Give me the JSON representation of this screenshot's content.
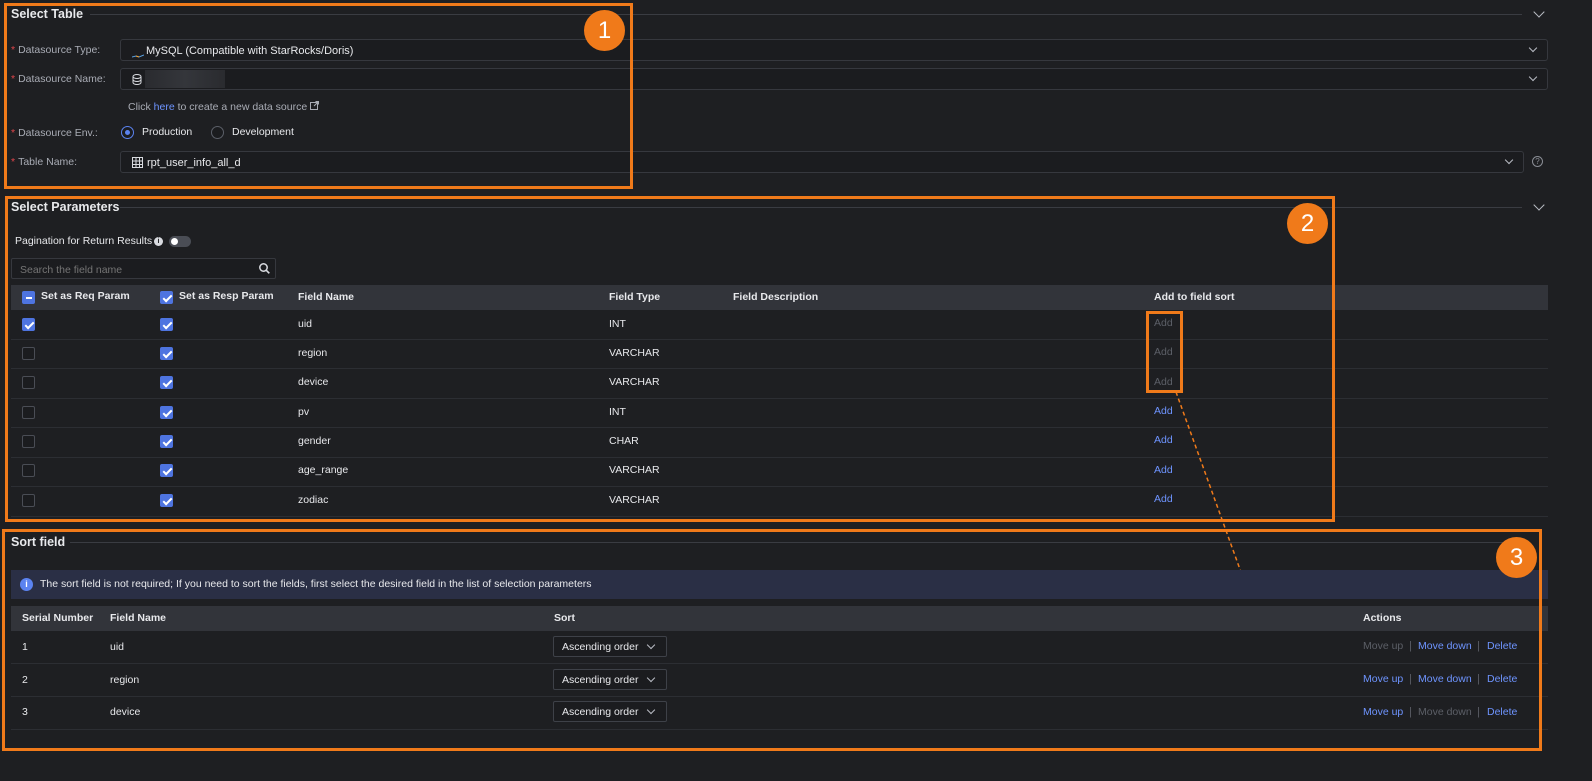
{
  "select_table": {
    "title": "Select Table",
    "datasource_type": {
      "label": "Datasource Type:",
      "value": "MySQL (Compatible with StarRocks/Doris)"
    },
    "datasource_name": {
      "label": "Datasource Name:",
      "value": ""
    },
    "create_hint": {
      "prefix": "Click ",
      "link": "here",
      "suffix": " to create a new data source"
    },
    "datasource_env": {
      "label": "Datasource Env.:",
      "options": [
        "Production",
        "Development"
      ],
      "selected": "Production"
    },
    "table_name": {
      "label": "Table Name:",
      "value": "rpt_user_info_all_d"
    }
  },
  "select_parameters": {
    "title": "Select Parameters",
    "pagination_label": "Pagination for Return Results",
    "pagination_enabled": false,
    "search_placeholder": "Search the field name",
    "columns": [
      "Set as Req Param",
      "Set as Resp Param",
      "Field Name",
      "Field Type",
      "Field Description",
      "Add to field sort"
    ],
    "rows": [
      {
        "req": true,
        "resp": true,
        "field": "uid",
        "type": "INT",
        "desc": "",
        "action": "Add",
        "action_enabled": false
      },
      {
        "req": false,
        "resp": true,
        "field": "region",
        "type": "VARCHAR",
        "desc": "",
        "action": "Add",
        "action_enabled": false
      },
      {
        "req": false,
        "resp": true,
        "field": "device",
        "type": "VARCHAR",
        "desc": "",
        "action": "Add",
        "action_enabled": false
      },
      {
        "req": false,
        "resp": true,
        "field": "pv",
        "type": "INT",
        "desc": "",
        "action": "Add",
        "action_enabled": true
      },
      {
        "req": false,
        "resp": true,
        "field": "gender",
        "type": "CHAR",
        "desc": "",
        "action": "Add",
        "action_enabled": true
      },
      {
        "req": false,
        "resp": true,
        "field": "age_range",
        "type": "VARCHAR",
        "desc": "",
        "action": "Add",
        "action_enabled": true
      },
      {
        "req": false,
        "resp": true,
        "field": "zodiac",
        "type": "VARCHAR",
        "desc": "",
        "action": "Add",
        "action_enabled": true
      }
    ]
  },
  "sort_field": {
    "title": "Sort field",
    "info": "The sort field is not required; If you need to sort the fields, first select the desired field in the list of selection parameters",
    "columns": [
      "Serial Number",
      "Field Name",
      "Sort",
      "Actions"
    ],
    "rows": [
      {
        "serial": "1",
        "field": "uid",
        "sort": "Ascending order",
        "move_up": "Move up",
        "move_down": "Move down",
        "delete": "Delete",
        "up_enabled": false,
        "down_enabled": true
      },
      {
        "serial": "2",
        "field": "region",
        "sort": "Ascending order",
        "move_up": "Move up",
        "move_down": "Move down",
        "delete": "Delete",
        "up_enabled": true,
        "down_enabled": true
      },
      {
        "serial": "3",
        "field": "device",
        "sort": "Ascending order",
        "move_up": "Move up",
        "move_down": "Move down",
        "delete": "Delete",
        "up_enabled": true,
        "down_enabled": false
      }
    ]
  },
  "annotations": {
    "badges": [
      "1",
      "2",
      "3"
    ],
    "highlight_color": "#f07a1a"
  },
  "colors": {
    "accent": "#6e94ff",
    "required": "#e0454b",
    "background": "#1e1f22"
  }
}
